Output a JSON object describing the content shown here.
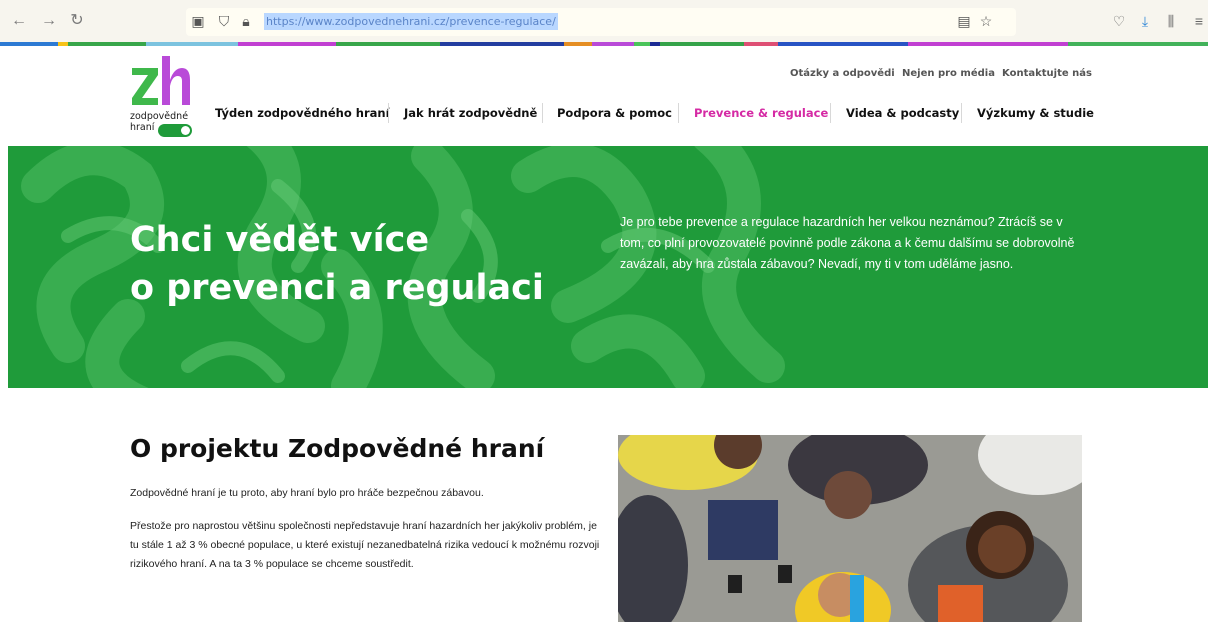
{
  "browser": {
    "url": "https://www.zodpovednehrani.cz/prevence-regulace/",
    "icons": {
      "back": "arrow-left-icon",
      "forward": "arrow-right-icon",
      "reload": "reload-icon",
      "page": "page-icon",
      "shield": "shield-icon",
      "lock": "lock-icon",
      "reader": "reader-icon",
      "bookmark": "star-icon",
      "pocket": "pocket-icon",
      "download": "download-icon",
      "library": "library-icon",
      "menu": "menu-icon"
    }
  },
  "logo": {
    "line1": "zodpovědné",
    "line2": "hraní",
    "colors": {
      "z": "#3fb84b",
      "h": "#b94ad8",
      "toggle": "#1f9b3a"
    }
  },
  "header": {
    "utility_nav": [
      "Otázky a odpovědi",
      "Nejen pro média",
      "Kontaktujte nás"
    ],
    "main_nav": [
      "Týden zodpovědného hraní",
      "Jak hrát zodpovědně",
      "Podpora & pomoc",
      "Prevence & regulace",
      "Videa & podcasty",
      "Výzkumy & studie"
    ],
    "active_color": "#d52aa4"
  },
  "hero": {
    "title_line1": "Chci vědět více",
    "title_line2": "o prevenci a regulaci",
    "text": "Je pro tebe prevence a regulace hazardních her velkou neznámou? Ztrácíš se v tom, co plní provozovatelé povinně podle zákona a k čemu dalšímu se dobrovolně zavázali, aby hra zůstala zábavou? Nevadí, my ti v tom uděláme jasno.",
    "background": "#1f9b3a"
  },
  "content": {
    "title": "O projektu Zodpovědné hraní",
    "p1": "Zodpovědné hraní je tu proto, aby hraní bylo pro hráče bezpečnou zábavou.",
    "p2": "Přestože pro naprostou většinu společnosti nepředstavuje hraní hazardních her jakýkoliv problém, je tu stále 1 až 3 % obecné populace, u které existují nezanedbatelná rizika vedoucí k možnému rozvoji rizikového hraní. A na ta 3 % populace se chceme soustředit."
  }
}
